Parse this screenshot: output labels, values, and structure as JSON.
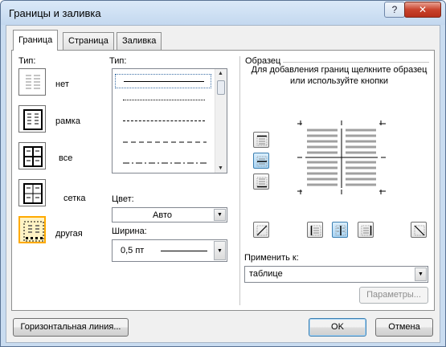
{
  "window": {
    "title": "Границы и заливка",
    "help_label": "?",
    "close_label": "✕"
  },
  "tabs": [
    {
      "label": "Граница",
      "active": true
    },
    {
      "label": "Страница",
      "active": false
    },
    {
      "label": "Заливка",
      "active": false
    }
  ],
  "type_section": {
    "label": "Тип:",
    "presets": [
      {
        "label": "нет",
        "icon": "border-none-icon"
      },
      {
        "label": "рамка",
        "icon": "border-box-icon"
      },
      {
        "label": "все",
        "icon": "border-all-icon"
      },
      {
        "label": "сетка",
        "icon": "border-grid-icon"
      },
      {
        "label": "другая",
        "icon": "border-custom-icon",
        "selected": true
      }
    ]
  },
  "style_section": {
    "label": "Тип:",
    "styles": [
      "solid",
      "dotted",
      "dashed-small",
      "dashed",
      "dash-dot"
    ],
    "selected_index": 0,
    "color_label": "Цвет:",
    "color_value": "Авто",
    "width_label": "Ширина:",
    "width_value": "0,5 пт"
  },
  "preview_section": {
    "label": "Образец",
    "hint": "Для добавления границ щелкните образец или используйте кнопки"
  },
  "apply_to": {
    "label": "Применить к:",
    "value": "таблице"
  },
  "buttons": {
    "options": "Параметры...",
    "horizontal_line": "Горизонтальная линия...",
    "ok": "OK",
    "cancel": "Отмена"
  },
  "colors": {
    "selection": "#ffaa00",
    "accent": "#3c7fb1"
  }
}
